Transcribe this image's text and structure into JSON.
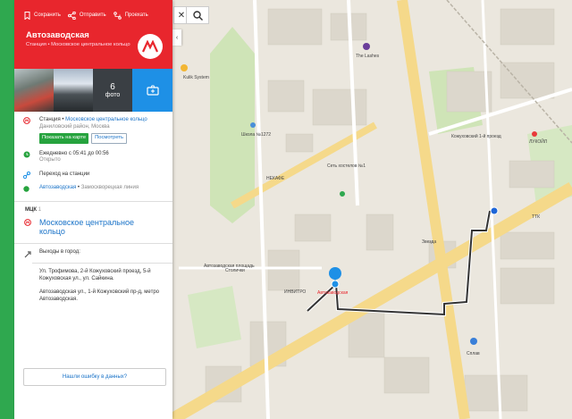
{
  "header": {
    "actions": [
      "Сохранить",
      "Отправить",
      "Проехать"
    ],
    "title": "Автозаводская",
    "subtitle": "Станция • Московское центральное кольцо"
  },
  "photos": {
    "count": "6",
    "label": "фото"
  },
  "station": {
    "type": "Станция",
    "line_link": "Московское центральное кольцо",
    "district": "Даниловский район, Москва",
    "show_on_map": "Показать на карте",
    "look": "Посмотреть"
  },
  "hours": {
    "text": "Ежедневно с 05:41 до 00:56",
    "status": "Открыто"
  },
  "transfer": {
    "title": "Переход на станции",
    "station": "Автозаводская",
    "line": "Замоскворецкая линия"
  },
  "mck": {
    "label": "МЦК",
    "count": "1",
    "line": "Московское центральное кольцо"
  },
  "exits": {
    "title": "Выходы в город:",
    "exit1": "Ул. Трофимова, 2-й Кожуховский проезд, 5-й Кожуховская ул., ул. Сайкина.",
    "exit2": "Автозаводская ул., 1-й Кожуховский пр-д, метро Автозаводская."
  },
  "error_link": "Нашли ошибку в данных?",
  "map_labels": {
    "lashes": "The Lashes",
    "kulik": "Kulik System",
    "school": "Школа №1272",
    "necafe": "НЕКАФЕ",
    "hostel": "Сеть хостелов №1",
    "invitro": "ИНВИТРО",
    "stolichki": "Столички",
    "metro_station": "Автозаводская",
    "avtozavodskaya_sq": "Автозаводская площадь",
    "kozhukh": "Кожуховский 1-й проезд",
    "lukoil": "ЛУКОЙЛ",
    "zvezda": "Звезда",
    "sbp": "Сплав",
    "ttk": "ТТК"
  },
  "colors": {
    "brand_red": "#e8262d",
    "route": "#333333",
    "mck_green": "#2fa84f",
    "accent_blue": "#1e90e6"
  }
}
